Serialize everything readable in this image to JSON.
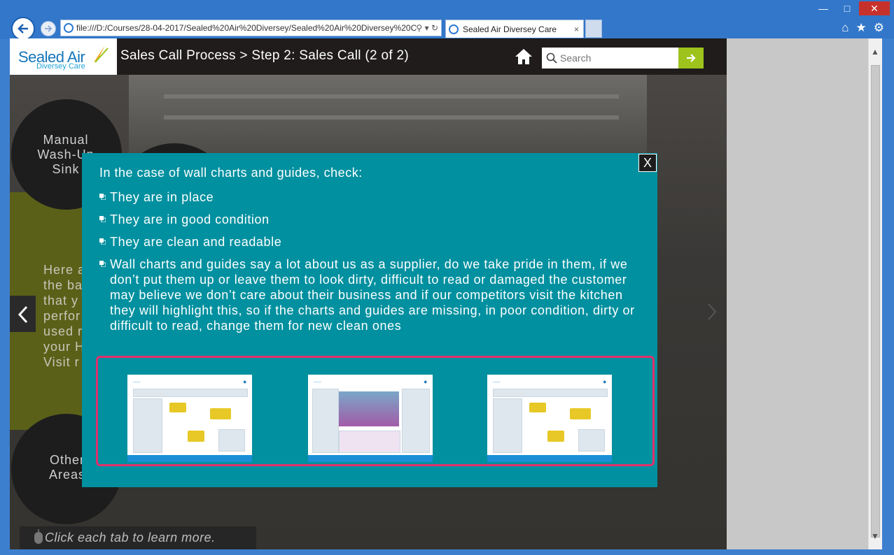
{
  "browser": {
    "address": "file:///D:/Courses/28-04-2017/Sealed%20Air%20Diversey/Sealed%20Air%20Diversey%20C",
    "tab_title": "Sealed Air Diversey Care",
    "tab_close": "×",
    "window_controls": {
      "minimize": "—",
      "maximize": "□",
      "close": "✕"
    },
    "tools": {
      "home": "home-icon",
      "favorites": "star-icon",
      "settings": "gear-icon"
    }
  },
  "header": {
    "logo_main": "Sealed Air",
    "logo_sub": "Diversey Care",
    "title": "Sales Call Process > Step 2: Sales Call (2 of 2)",
    "search_placeholder": "Search"
  },
  "background": {
    "circle_top": "Manual Wash-Up Sink",
    "circle_bottom": "Other Areas",
    "side_text": [
      "Here a",
      "the ba",
      "that y",
      "perfor",
      "used r",
      "your H",
      "Visit r"
    ],
    "hint": "Click each tab to learn more."
  },
  "modal": {
    "close_label": "X",
    "heading": "In the case of wall charts and guides, check:",
    "bullets": [
      "They are in place",
      "They are in good condition",
      "They are clean and readable",
      "Wall charts and guides say a lot about us as a supplier, do we take pride in them, if we don’t put them up or leave them to look dirty, difficult to read or damaged the customer may believe we don’t care about their business and if our competitors visit the kitchen they will highlight this, so if the charts and guides are missing, in poor condition, dirty or difficult to read, change them for new clean ones"
    ]
  },
  "colors": {
    "modal_bg": "#00909f",
    "accent_green": "#9dc31c",
    "thumb_border": "#e0306b",
    "header_bg": "#1f1c1b"
  }
}
